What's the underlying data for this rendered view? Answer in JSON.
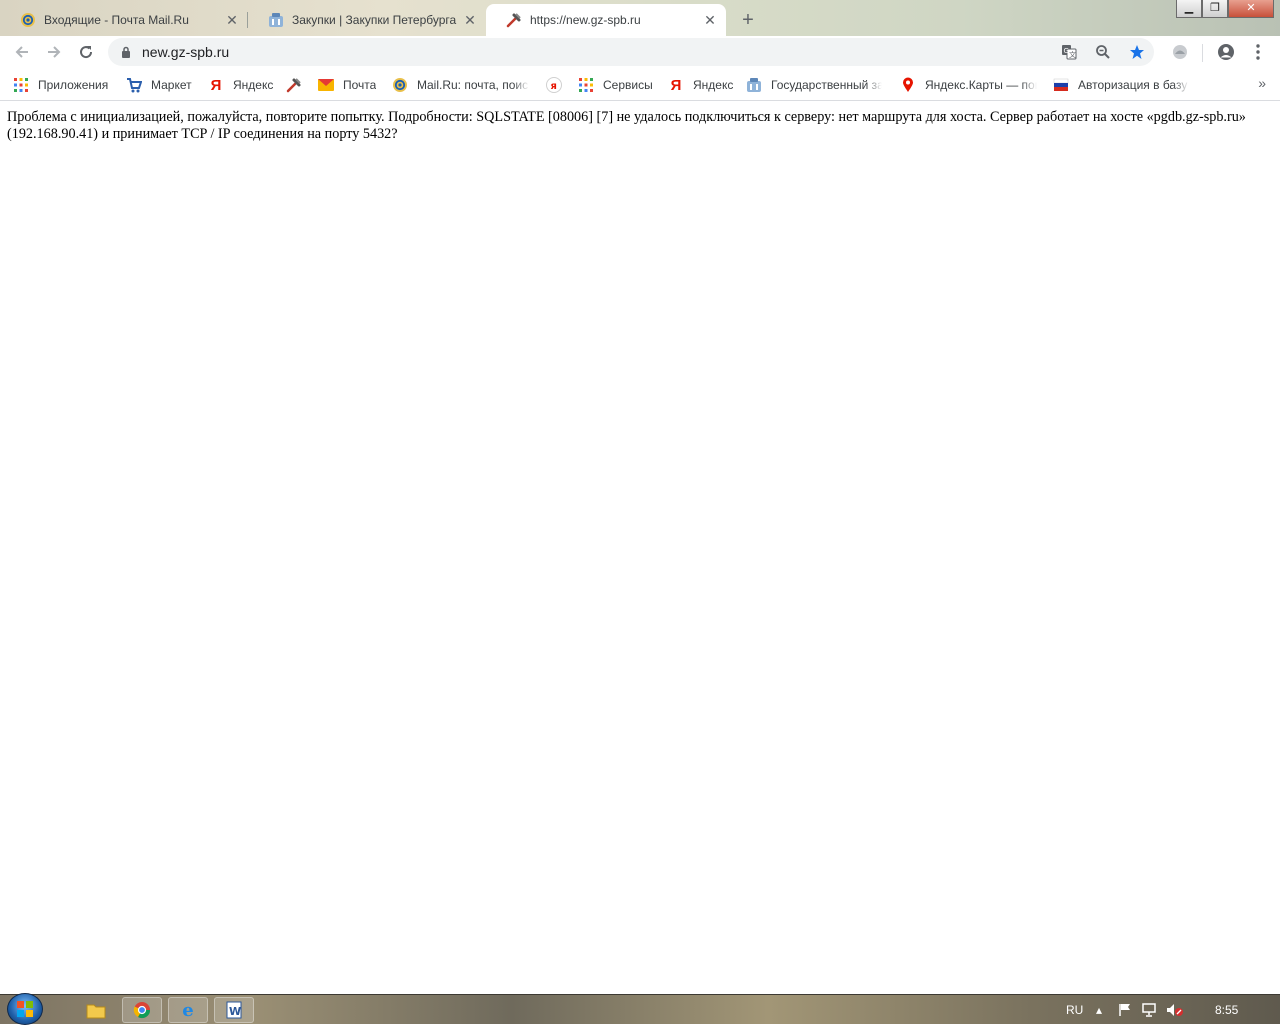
{
  "tabs": [
    {
      "title": "Входящие - Почта Mail.Ru",
      "active": false,
      "favicon": "mailru-at-icon"
    },
    {
      "title": "Закупки | Закупки Петербурга",
      "active": false,
      "favicon": "gz-building-icon"
    },
    {
      "title": "https://new.gz-spb.ru",
      "active": true,
      "favicon": "tools-icon"
    }
  ],
  "toolbar": {
    "url": "new.gz-spb.ru"
  },
  "bookmarks": [
    {
      "label": "Приложения",
      "icon": "apps-grid-icon"
    },
    {
      "label": "Маркет",
      "icon": "cart-icon"
    },
    {
      "label": "Яндекс",
      "icon": "yandex-icon"
    },
    {
      "label": "",
      "icon": "tools-icon"
    },
    {
      "label": "Почта",
      "icon": "mail-envelope-icon"
    },
    {
      "label": "Mail.Ru: почта, поис",
      "icon": "mailru-at-icon"
    },
    {
      "label": "",
      "icon": "yandex-badge-icon"
    },
    {
      "label": "Сервисы",
      "icon": "apps-grid-icon"
    },
    {
      "label": "Яндекс",
      "icon": "yandex-icon"
    },
    {
      "label": "Государственный за",
      "icon": "gz-building-icon"
    },
    {
      "label": "Яндекс.Карты — пог",
      "icon": "map-pin-icon"
    },
    {
      "label": "Авторизация в базу",
      "icon": "flag-icon"
    }
  ],
  "page": {
    "message": "Проблема с инициализацией, пожалуйста, повторите попытку. Подробности: SQLSTATE [08006] [7] не удалось подключиться к серверу: нет маршрута для хоста. Сервер работает на хосте «pgdb.gz-spb.ru» (192.168.90.41) и принимает TCP / IP соединения на порту 5432?"
  },
  "taskbar": {
    "language": "RU",
    "clock": "8:55"
  },
  "colors": {
    "accent_star": "#1a73e8",
    "yandex_red": "#e61400",
    "omnibox_bg": "#f1f3f4"
  }
}
